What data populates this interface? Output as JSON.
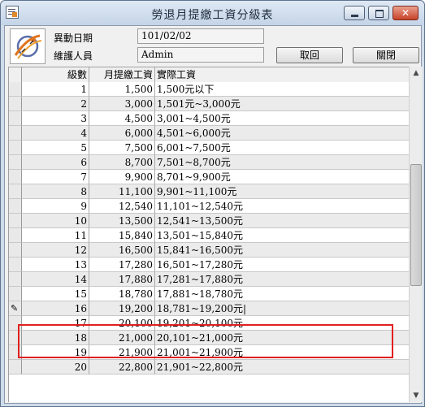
{
  "window": {
    "title": "勞退月提繳工資分級表",
    "title_icon": "form-icon",
    "controls": [
      "minimize-icon",
      "maximize-icon",
      "close-icon"
    ]
  },
  "form": {
    "change_date_label": "異動日期",
    "change_date_value": "101/02/02",
    "maintainer_label": "維護人員",
    "maintainer_value": "Admin",
    "cancel_label": "取回",
    "close_label": "關閉",
    "logo_icon": "satellite-logo-icon"
  },
  "grid": {
    "headers": [
      "級數",
      "月提繳工資",
      "實際工資"
    ],
    "rows": [
      {
        "level": "1",
        "amount": "1,500",
        "range": "1,500元以下"
      },
      {
        "level": "2",
        "amount": "3,000",
        "range": "1,501元~3,000元"
      },
      {
        "level": "3",
        "amount": "4,500",
        "range": "3,001~4,500元"
      },
      {
        "level": "4",
        "amount": "6,000",
        "range": "4,501~6,000元"
      },
      {
        "level": "5",
        "amount": "7,500",
        "range": "6,001~7,500元"
      },
      {
        "level": "6",
        "amount": "8,700",
        "range": "7,501~8,700元"
      },
      {
        "level": "7",
        "amount": "9,900",
        "range": "8,701~9,900元"
      },
      {
        "level": "8",
        "amount": "11,100",
        "range": "9,901~11,100元"
      },
      {
        "level": "9",
        "amount": "12,540",
        "range": "11,101~12,540元"
      },
      {
        "level": "10",
        "amount": "13,500",
        "range": "12,541~13,500元"
      },
      {
        "level": "11",
        "amount": "15,840",
        "range": "13,501~15,840元"
      },
      {
        "level": "12",
        "amount": "16,500",
        "range": "15,841~16,500元"
      },
      {
        "level": "13",
        "amount": "17,280",
        "range": "16,501~17,280元"
      },
      {
        "level": "14",
        "amount": "17,880",
        "range": "17,281~17,880元"
      },
      {
        "level": "15",
        "amount": "18,780",
        "range": "17,881~18,780元"
      },
      {
        "level": "16",
        "amount": "19,200",
        "range": "18,781~19,200元|"
      },
      {
        "level": "17",
        "amount": "20,100",
        "range": "19,201~20,100元"
      },
      {
        "level": "18",
        "amount": "21,000",
        "range": "20,101~21,000元"
      },
      {
        "level": "19",
        "amount": "21,900",
        "range": "21,001~21,900元"
      },
      {
        "level": "20",
        "amount": "22,800",
        "range": "21,901~22,800元"
      }
    ],
    "editing_row_marker": "✎",
    "highlight_color": "#e02020"
  }
}
